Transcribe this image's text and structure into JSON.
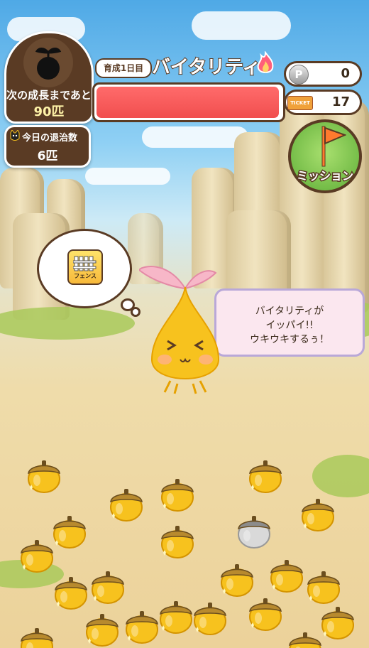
{
  "hud": {
    "growth_label": "次の成長まであと",
    "growth_value": "90匹",
    "defeat_label": "今日の退治数",
    "defeat_value": "6匹",
    "day_label": "育成1日目",
    "vitality_title": "バイタリティ",
    "vitality_level": 0.99,
    "coin_count": "0",
    "ticket_count": "17",
    "coin_icon_letter": "P",
    "ticket_icon_label": "TICKET",
    "mission_label": "ミッション"
  },
  "thought": {
    "item_label": "フェンス"
  },
  "speech": {
    "line1": "バイタリティが",
    "line2": "イッパイ!!",
    "line3": "ウキウキするぅ！"
  },
  "icons": [
    "sprout-silhouette-icon",
    "cat-face-icon",
    "fire-icon",
    "coin-icon",
    "ticket-icon",
    "flag-icon",
    "fence-icon",
    "acorn-icon"
  ],
  "colors": {
    "frame": "#5a3b24",
    "vitality_fill": "#f14e4e",
    "acorn_gold": "#f7c21e",
    "acorn_silver": "#c9c9c9"
  },
  "acorns": [
    {
      "variant": "gold"
    },
    {
      "variant": "gold"
    },
    {
      "variant": "gold"
    },
    {
      "variant": "gold"
    },
    {
      "variant": "gold"
    },
    {
      "variant": "gold"
    },
    {
      "variant": "gold"
    },
    {
      "variant": "silver"
    },
    {
      "variant": "gold"
    },
    {
      "variant": "gold"
    },
    {
      "variant": "gold"
    },
    {
      "variant": "gold"
    },
    {
      "variant": "gold"
    },
    {
      "variant": "gold"
    },
    {
      "variant": "gold"
    },
    {
      "variant": "gold"
    },
    {
      "variant": "gold"
    },
    {
      "variant": "gold"
    },
    {
      "variant": "gold"
    },
    {
      "variant": "gold"
    },
    {
      "variant": "gold"
    },
    {
      "variant": "gold"
    }
  ]
}
